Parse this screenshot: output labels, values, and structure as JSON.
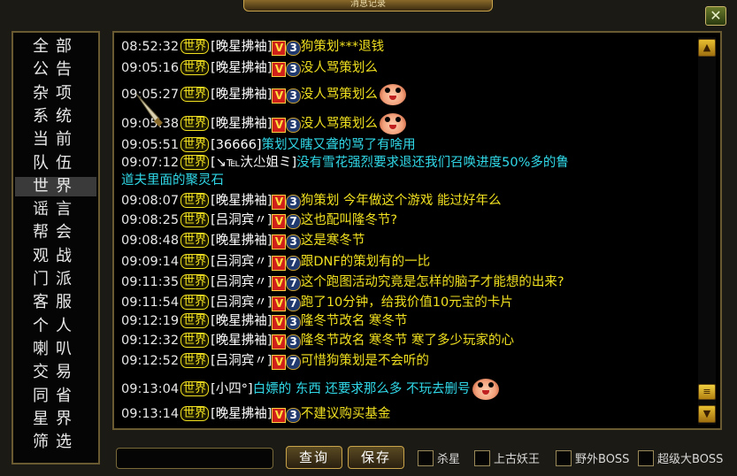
{
  "window": {
    "title": "消息记录",
    "close_symbol": "✕"
  },
  "sidebar": {
    "items": [
      {
        "label": "全部"
      },
      {
        "label": "公告"
      },
      {
        "label": "杂项"
      },
      {
        "label": "系统"
      },
      {
        "label": "当前"
      },
      {
        "label": "队伍"
      },
      {
        "label": "世界",
        "active": true
      },
      {
        "label": "谣言"
      },
      {
        "label": "帮会"
      },
      {
        "label": "观战"
      },
      {
        "label": "门派"
      },
      {
        "label": "客服"
      },
      {
        "label": "个人"
      },
      {
        "label": "喇叭"
      },
      {
        "label": "交易"
      },
      {
        "label": "同省"
      },
      {
        "label": "星界"
      },
      {
        "label": "筛选"
      }
    ]
  },
  "channel_tag": "世界",
  "messages": [
    {
      "time": "08:52:32",
      "sender": "[晚星拂袖]",
      "vip": "V",
      "level": "3",
      "text": "狗策划***退钱",
      "color": "yellow",
      "face": false
    },
    {
      "time": "09:05:16",
      "sender": "[晚星拂袖]",
      "vip": "V",
      "level": "3",
      "text": "没人骂策划么",
      "color": "yellow",
      "face": false
    },
    {
      "time": "09:05:27",
      "sender": "[晚星拂袖]",
      "vip": "V",
      "level": "3",
      "text": "没人骂策划么",
      "color": "yellow",
      "face": true
    },
    {
      "time": "09:05:38",
      "sender": "[晚星拂袖]",
      "vip": "V",
      "level": "3",
      "text": "没人骂策划么",
      "color": "yellow",
      "face": true
    },
    {
      "time": "09:05:51",
      "sender": "[36666]",
      "vip": "",
      "level": "",
      "text": "策划又瞎又聋的骂了有啥用",
      "color": "cyan",
      "face": false
    },
    {
      "time": "09:07:12",
      "sender": "[↘℡汏尐姐ミ]",
      "vip": "",
      "level": "",
      "text": "没有雪花强烈要求退还我们召唤进度50%多的鲁",
      "text2": "道夫里面的聚灵石",
      "color": "cyan",
      "face": false
    },
    {
      "time": "09:08:07",
      "sender": "[晚星拂袖]",
      "vip": "V",
      "level": "3",
      "text": "狗策划  今年做这个游戏   能过好年么",
      "color": "yellow",
      "face": false
    },
    {
      "time": "09:08:25",
      "sender": "[吕洞宾〃]",
      "vip": "V",
      "level": "7",
      "text": "这也配叫隆冬节?",
      "color": "yellow",
      "face": false
    },
    {
      "time": "09:08:48",
      "sender": "[晚星拂袖]",
      "vip": "V",
      "level": "3",
      "text": "这是寒冬节",
      "color": "yellow",
      "face": false
    },
    {
      "time": "09:09:14",
      "sender": "[吕洞宾〃]",
      "vip": "V",
      "level": "7",
      "text": "跟DNF的策划有的一比",
      "color": "yellow",
      "face": false
    },
    {
      "time": "09:11:35",
      "sender": "[吕洞宾〃]",
      "vip": "V",
      "level": "7",
      "text": "这个跑图活动究竟是怎样的脑子才能想的出来?",
      "color": "yellow",
      "face": false
    },
    {
      "time": "09:11:54",
      "sender": "[吕洞宾〃]",
      "vip": "V",
      "level": "7",
      "text": "跑了10分钟，给我价值10元宝的卡片",
      "color": "yellow",
      "face": false
    },
    {
      "time": "09:12:19",
      "sender": "[晚星拂袖]",
      "vip": "V",
      "level": "3",
      "text": "隆冬节改名  寒冬节",
      "color": "yellow",
      "face": false
    },
    {
      "time": "09:12:32",
      "sender": "[晚星拂袖]",
      "vip": "V",
      "level": "3",
      "text": "隆冬节改名  寒冬节  寒了多少玩家的心",
      "color": "yellow",
      "face": false
    },
    {
      "time": "09:12:52",
      "sender": "[吕洞宾〃]",
      "vip": "V",
      "level": "7",
      "text": "可惜狗策划是不会听的",
      "color": "yellow",
      "face": false
    },
    {
      "time": "09:13:04",
      "sender": "[小四°]",
      "vip": "",
      "level": "",
      "text": "白嫖的  东西  还要求那么多       不玩去删号",
      "color": "cyan",
      "face": true
    },
    {
      "time": "09:13:14",
      "sender": "[晚星拂袖]",
      "vip": "V",
      "level": "3",
      "text": "不建议购买基金",
      "color": "yellow",
      "face": false
    }
  ],
  "scrollbar": {
    "up_symbol": "▲",
    "down_symbol": "▼",
    "thumb_symbol": "≡"
  },
  "bottom": {
    "input_value": "",
    "query_label": "查询",
    "save_label": "保存",
    "filters": [
      {
        "label": "杀星",
        "checked": false
      },
      {
        "label": "上古妖王",
        "checked": false
      },
      {
        "label": "野外BOSS",
        "checked": false
      },
      {
        "label": "超级大BOSS",
        "checked": false
      }
    ]
  },
  "colors": {
    "yellow": "#f0e020",
    "cyan": "#30d8e8",
    "border": "#6a5a32"
  }
}
